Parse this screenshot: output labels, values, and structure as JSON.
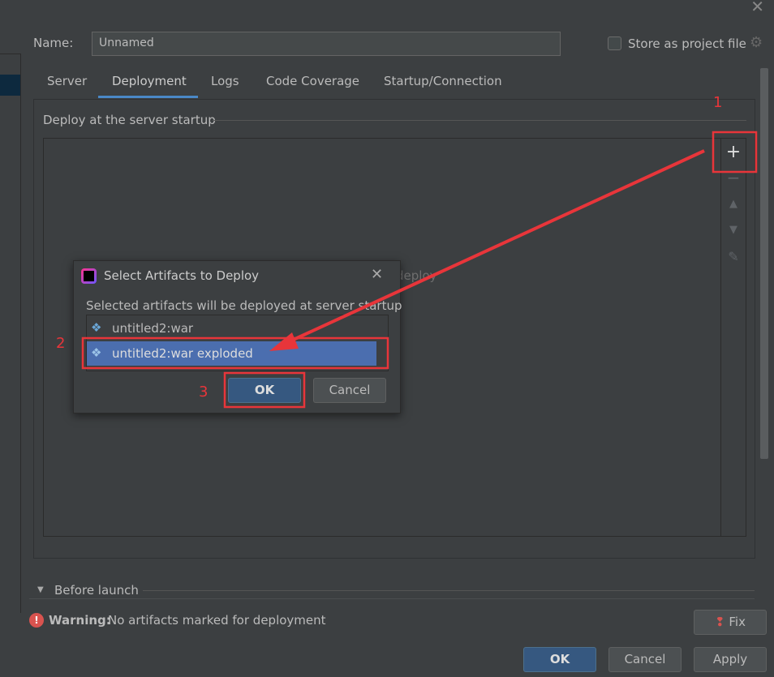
{
  "header": {
    "name_label": "Name:",
    "name_value": "Unnamed",
    "store_label": "Store as project file"
  },
  "tabs": [
    {
      "label": "Server"
    },
    {
      "label": "Deployment",
      "active": true
    },
    {
      "label": "Logs"
    },
    {
      "label": "Code Coverage"
    },
    {
      "label": "Startup/Connection"
    }
  ],
  "deploy": {
    "section_label": "Deploy at the server startup",
    "empty_text_visible": "deploy"
  },
  "dialog": {
    "title": "Select Artifacts to Deploy",
    "description": "Selected artifacts will be deployed at server startup",
    "artifacts": [
      {
        "label": "untitled2:war",
        "selected": false
      },
      {
        "label": "untitled2:war exploded",
        "selected": true
      }
    ],
    "ok_label": "OK",
    "cancel_label": "Cancel"
  },
  "before_launch_label": "Before launch",
  "warning": {
    "prefix": "Warning:",
    "text": "No artifacts marked for deployment",
    "fix_label": "Fix"
  },
  "footer": {
    "ok_label": "OK",
    "cancel_label": "Cancel",
    "apply_label": "Apply"
  },
  "annotations": {
    "step1": "1",
    "step2": "2",
    "step3": "3",
    "color": "#e8353a"
  },
  "colors": {
    "accent": "#4a88c7",
    "selection": "#4b6eaf",
    "default_button": "#365880"
  }
}
